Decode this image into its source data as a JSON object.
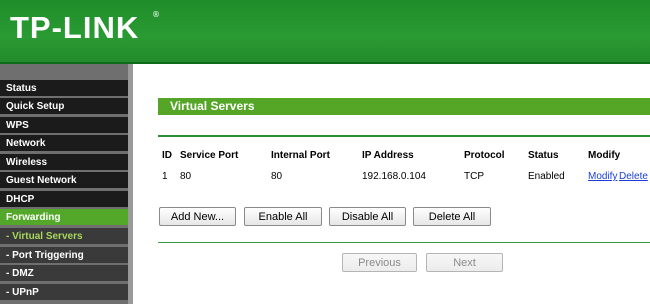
{
  "header": {
    "logo_text": "TP-LINK",
    "trademark": "®"
  },
  "sidebar": {
    "items": [
      {
        "label": "Status"
      },
      {
        "label": "Quick Setup"
      },
      {
        "label": "WPS"
      },
      {
        "label": "Network"
      },
      {
        "label": "Wireless"
      },
      {
        "label": "Guest Network"
      },
      {
        "label": "DHCP"
      },
      {
        "label": "Forwarding"
      },
      {
        "label": "- Virtual Servers"
      },
      {
        "label": "- Port Triggering"
      },
      {
        "label": "- DMZ"
      },
      {
        "label": "- UPnP"
      }
    ]
  },
  "main": {
    "section_title": "Virtual Servers",
    "table": {
      "headers": [
        "ID",
        "Service Port",
        "Internal Port",
        "IP Address",
        "Protocol",
        "Status",
        "Modify"
      ],
      "rows": [
        {
          "id": "1",
          "service_port": "80",
          "internal_port": "80",
          "ip": "192.168.0.104",
          "protocol": "TCP",
          "status": "Enabled",
          "modify": "Modify",
          "delete": "Delete"
        }
      ]
    },
    "buttons": {
      "add_new": "Add New...",
      "enable_all": "Enable All",
      "disable_all": "Disable All",
      "delete_all": "Delete All"
    },
    "pager": {
      "previous": "Previous",
      "next": "Next"
    }
  },
  "colors": {
    "brand_green": "#2a9a33",
    "section_green": "#55a626",
    "active_nav": "#54a829",
    "active_sub_text": "#a6d85a",
    "link_blue": "#1a3fd6"
  }
}
